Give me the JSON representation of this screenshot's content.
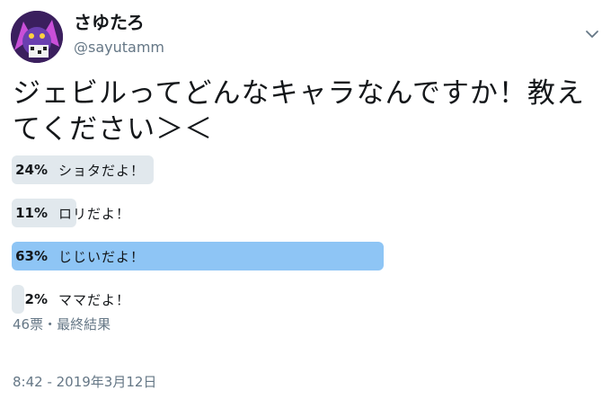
{
  "author": {
    "display_name": "さゆたろ",
    "handle": "@sayutamm"
  },
  "tweet": {
    "text": "ジェビルってどんなキャラなんですか！教えてください＞＜"
  },
  "poll": {
    "options": [
      {
        "percent_label": "24%",
        "percent": 24,
        "label": "ショタだよ！",
        "winner": false
      },
      {
        "percent_label": "11%",
        "percent": 11,
        "label": "ロリだよ！",
        "winner": false
      },
      {
        "percent_label": "63%",
        "percent": 63,
        "label": "じじいだよ！",
        "winner": true
      },
      {
        "percent_label": "2%",
        "percent": 2,
        "label": "ママだよ！",
        "winner": false
      }
    ],
    "summary": "46票・最終結果"
  },
  "timestamp": "8:42 - 2019年3月12日",
  "icons": {
    "menu": "chevron-down-icon",
    "avatar": "avatar-icon"
  },
  "colors": {
    "winner_bar": "#8ec5f5",
    "bar": "#e1e8ed",
    "secondary_text": "#657786"
  }
}
